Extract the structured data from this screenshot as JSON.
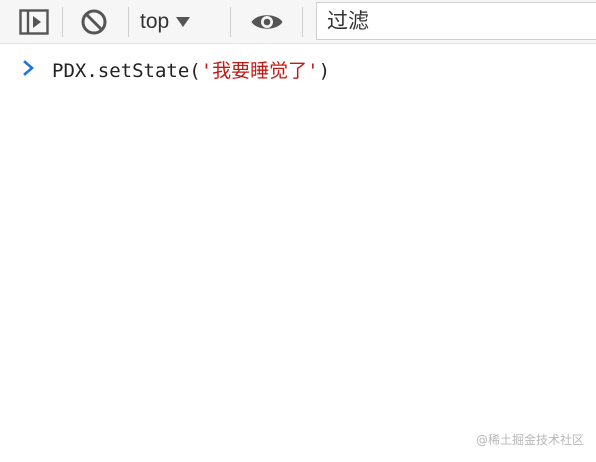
{
  "toolbar": {
    "context_value": "top",
    "filter_placeholder": "过滤",
    "icon_color": "#555555"
  },
  "console": {
    "entries": [
      {
        "code_prefix": "PDX.setState(",
        "code_string": "'我要睡觉了'",
        "code_suffix": ")"
      }
    ],
    "prompt_color": "#1a73e8",
    "string_color": "#c41a16"
  },
  "watermark": "@稀土掘金技术社区"
}
